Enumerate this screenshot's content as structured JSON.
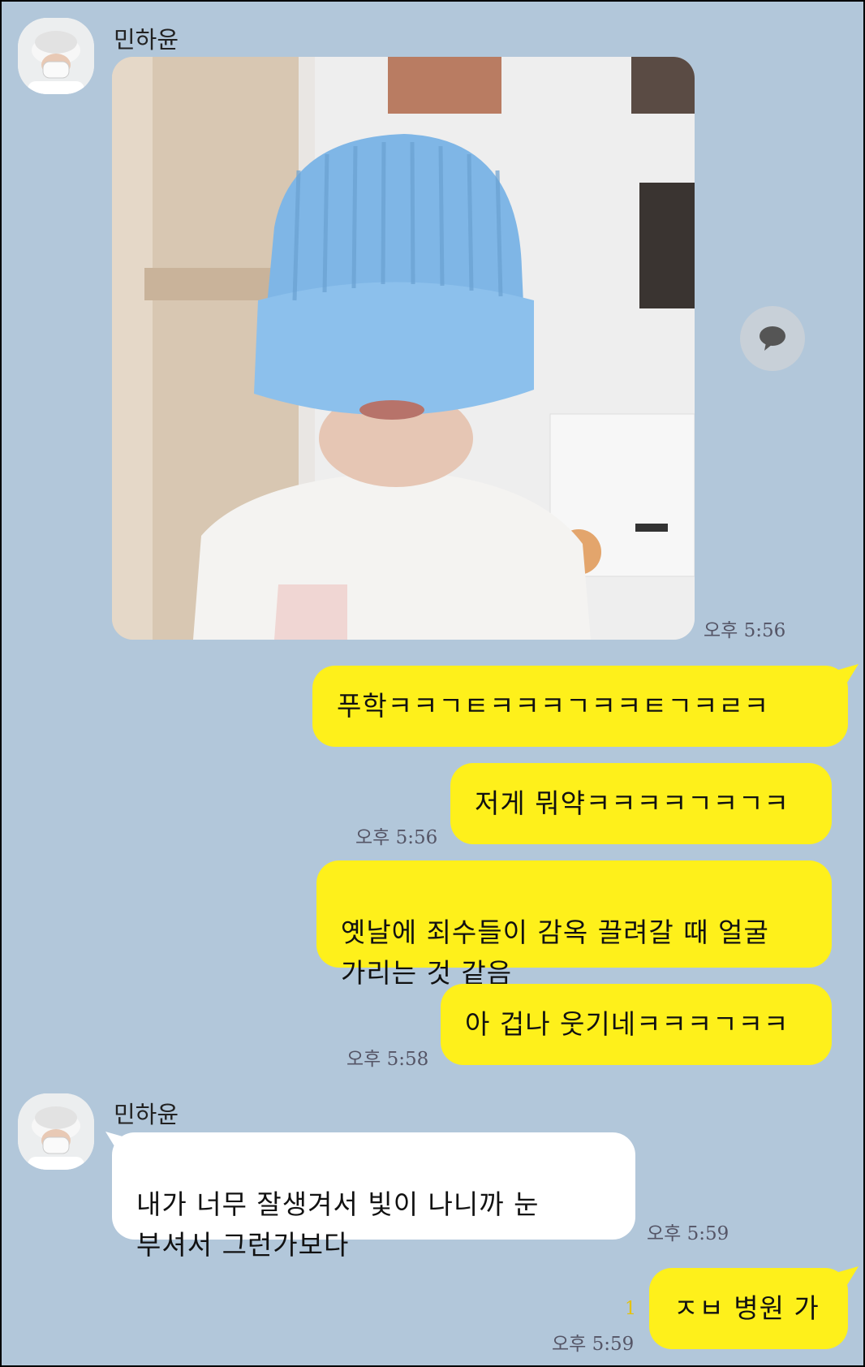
{
  "chat": {
    "sender_name": "민하윤",
    "photo_time": "오후 5:56",
    "messages": [
      {
        "text": "푸학ㅋㅋㄱㅌㅋㅋㅋㄱㅋㅋㅌㄱㅋㄹㅋ",
        "time": ""
      },
      {
        "text": "저게 뭐약ㅋㅋㅋㅋㄱㅋㄱㅋ",
        "time": "오후 5:56"
      },
      {
        "text": "옛날에 죄수들이 감옥 끌려갈 때 얼굴\n가리는 것 같음",
        "time": ""
      },
      {
        "text": "아 겁나 웃기네ㅋㅋㅋㄱㅋㅋ",
        "time": "오후 5:58"
      },
      {
        "text": "내가 너무 잘생겨서 빛이 나니까 눈\n부셔서 그런가보다",
        "time": "오후 5:59"
      },
      {
        "text": "ㅈㅂ 병원 가",
        "time": "오후 5:59",
        "unread": "1"
      }
    ]
  },
  "icons": {
    "share": "speech-bubble-icon"
  },
  "colors": {
    "background": "#b2c7da",
    "my_bubble": "#fef01b",
    "their_bubble": "#ffffff"
  }
}
